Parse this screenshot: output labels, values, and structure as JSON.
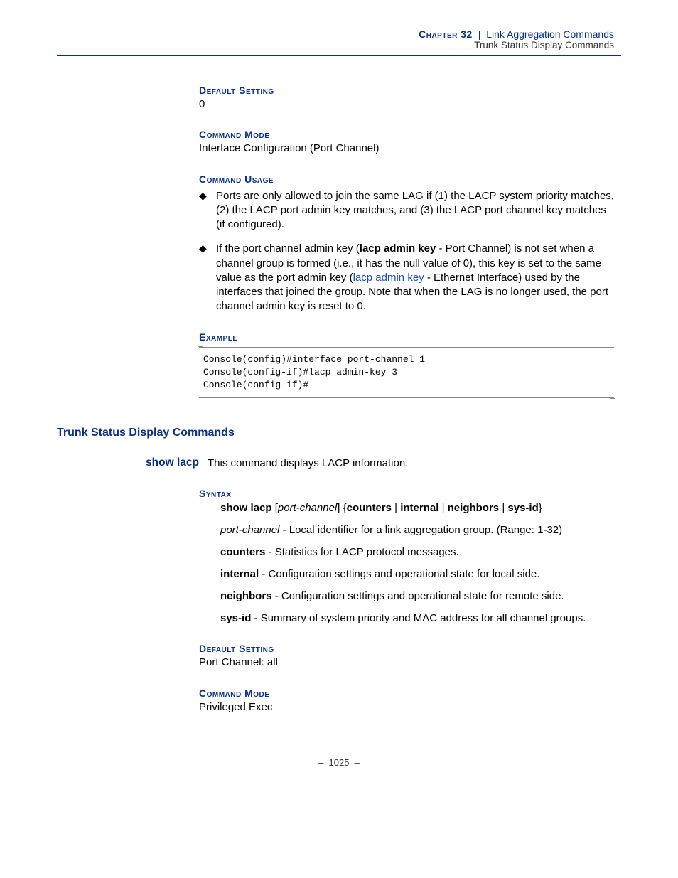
{
  "header": {
    "chapter": "Chapter 32",
    "sep": "|",
    "title": "Link Aggregation Commands",
    "subtitle": "Trunk Status Display Commands"
  },
  "s1": {
    "default_label": "Default Setting",
    "default_value": "0",
    "mode_label": "Command Mode",
    "mode_value": "Interface Configuration (Port Channel)",
    "usage_label": "Command Usage",
    "bullet1": "Ports are only allowed to join the same LAG if (1) the LACP system priority matches, (2) the LACP port admin key matches, and (3) the LACP port channel key matches (if configured).",
    "bullet2_a": "If the port channel admin key (",
    "bullet2_b": "lacp admin key",
    "bullet2_c": " - Port Channel) is not set when a channel group is formed (i.e., it has the null value of 0), this key is set to the same value as the port admin key (",
    "bullet2_link": "lacp admin key",
    "bullet2_d": " - Ethernet Interface) used by the interfaces that joined the group. Note that when the LAG is no longer used, the port channel admin key is reset to 0.",
    "example_label": "Example",
    "example_code": "Console(config)#interface port-channel 1\nConsole(config-if)#lacp admin-key 3\nConsole(config-if)#"
  },
  "section_heading": "Trunk Status Display Commands",
  "cmd": {
    "name": "show lacp",
    "desc": "This command displays LACP information.",
    "syntax_label": "Syntax",
    "syntax": {
      "cmd": "show lacp",
      "arg": "port-channel",
      "opts_a": "counters",
      "opts_b": "internal",
      "opts_c": "neighbors",
      "opts_d": "sys-id"
    },
    "params": {
      "pc_name": "port-channel",
      "pc_desc": " - Local identifier for a link aggregation group. (Range: 1-32)",
      "counters_name": "counters",
      "counters_desc": " - Statistics for LACP protocol messages.",
      "internal_name": "internal",
      "internal_desc": " - Configuration settings and operational state for local side.",
      "neighbors_name": "neighbors",
      "neighbors_desc": " - Configuration settings and operational state for remote side.",
      "sysid_name": "sys-id",
      "sysid_desc": " - Summary of system priority and MAC address for all channel groups."
    },
    "default_label": "Default Setting",
    "default_value": "Port Channel: all",
    "mode_label": "Command Mode",
    "mode_value": "Privileged Exec"
  },
  "footer": {
    "page": "–  1025  –"
  }
}
